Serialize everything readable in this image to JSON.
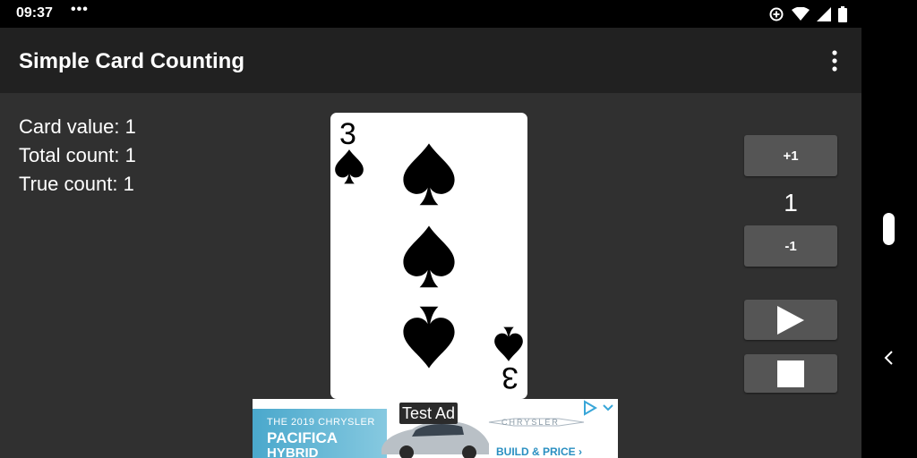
{
  "status_bar": {
    "time": "09:37",
    "dots": "•••",
    "icons": [
      "data-saver-icon",
      "wifi-icon",
      "signal-icon",
      "battery-icon"
    ]
  },
  "app_bar": {
    "title": "Simple Card Counting",
    "menu_icon": "overflow-menu-icon"
  },
  "stats": {
    "card_value": "Card value: 1",
    "total_count": "Total count: 1",
    "true_count": "True count: 1"
  },
  "card": {
    "rank": "3",
    "suit": "spades",
    "suit_symbol": "♠",
    "color": "#000000"
  },
  "controls": {
    "plus_label": "+1",
    "count": "1",
    "minus_label": "-1",
    "play_icon": "play-icon",
    "stop_icon": "stop-icon"
  },
  "ad": {
    "label": "Test Ad",
    "small": "THE 2019 CHRYSLER",
    "big1": "PACIFICA",
    "big2": "HYBRID",
    "brand": "CHRYSLER",
    "cta": "BUILD & PRICE ›"
  },
  "colors": {
    "app_bar": "#212121",
    "background": "#303030",
    "button": "#555555",
    "ad_blue": "#4aa8cc"
  }
}
